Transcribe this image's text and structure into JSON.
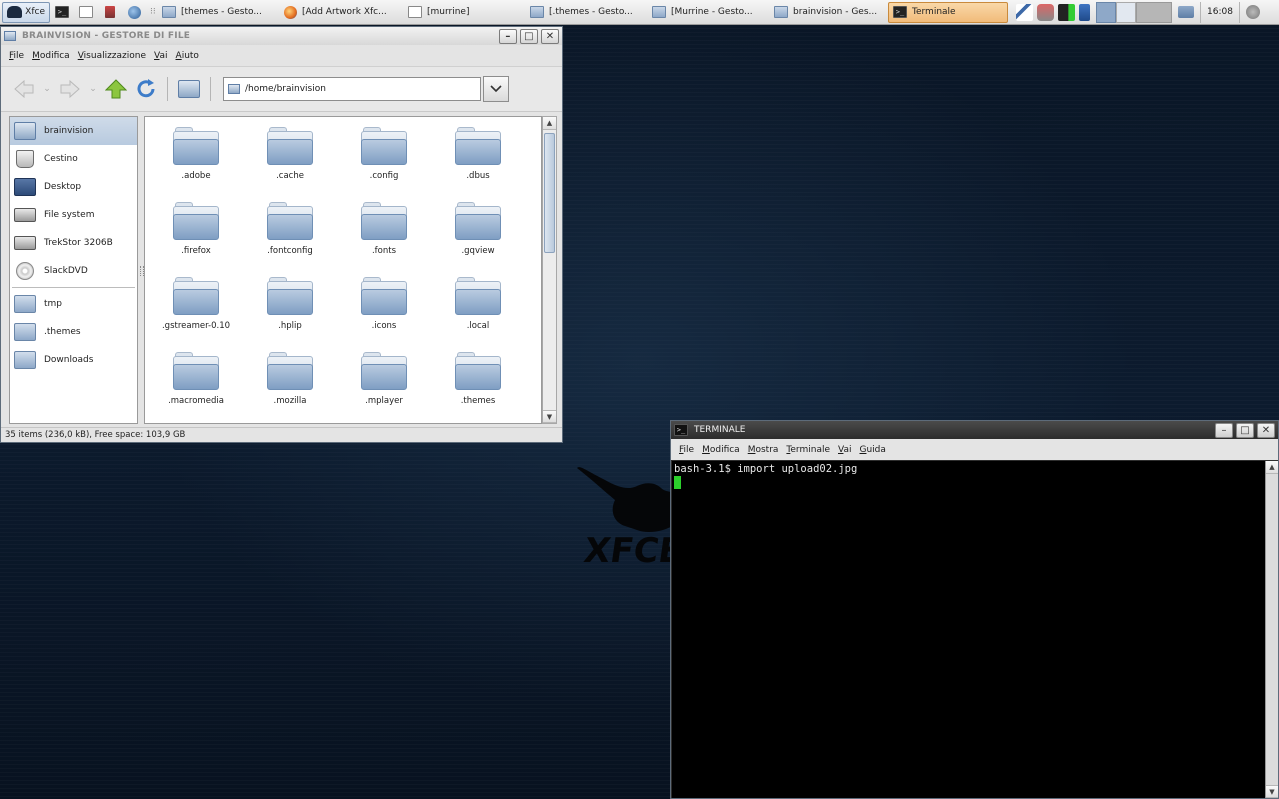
{
  "panel": {
    "xfce_label": "Xfce",
    "tasks": [
      {
        "label": "[themes - Gesto...",
        "icon": "folder-icon",
        "active": false
      },
      {
        "label": "[Add Artwork Xfc...",
        "icon": "firefox-icon",
        "active": false
      },
      {
        "label": "[murrine]",
        "icon": "document-icon",
        "active": false
      },
      {
        "label": "[.themes - Gesto...",
        "icon": "folder-icon",
        "active": false
      },
      {
        "label": "[Murrine - Gesto...",
        "icon": "folder-icon",
        "active": false
      },
      {
        "label": "brainvision - Ges...",
        "icon": "home-folder-icon",
        "active": false
      },
      {
        "label": "Terminale",
        "icon": "terminal-icon",
        "active": true
      }
    ],
    "clock": "16:08"
  },
  "file_manager": {
    "title": "BRAINVISION - GESTORE DI FILE",
    "menu": [
      "File",
      "Modifica",
      "Visualizzazione",
      "Vai",
      "Aiuto"
    ],
    "path": "/home/brainvision",
    "sidebar": [
      {
        "label": "brainvision",
        "icon": "home-icon",
        "selected": true
      },
      {
        "label": "Cestino",
        "icon": "trash-icon",
        "selected": false
      },
      {
        "label": "Desktop",
        "icon": "desktop-icon",
        "selected": false
      },
      {
        "label": "File system",
        "icon": "drive-icon",
        "selected": false
      },
      {
        "label": "TrekStor 3206B",
        "icon": "drive-icon",
        "selected": false
      },
      {
        "label": "SlackDVD",
        "icon": "cdrom-icon",
        "selected": false
      }
    ],
    "bookmarks": [
      {
        "label": "tmp",
        "icon": "folder-icon"
      },
      {
        "label": ".themes",
        "icon": "folder-icon"
      },
      {
        "label": "Downloads",
        "icon": "folder-icon"
      }
    ],
    "folders": [
      ".adobe",
      ".cache",
      ".config",
      ".dbus",
      ".firefox",
      ".fontconfig",
      ".fonts",
      ".gqview",
      ".gstreamer-0.10",
      ".hplip",
      ".icons",
      ".local",
      ".macromedia",
      ".mozilla",
      ".mplayer",
      ".themes"
    ],
    "status": "35 items (236,0 kB), Free space: 103,9 GB"
  },
  "terminal": {
    "title": "TERMINALE",
    "menu": [
      "File",
      "Modifica",
      "Mostra",
      "Terminale",
      "Vai",
      "Guida"
    ],
    "line1": "bash-3.1$ import upload02.jpg"
  },
  "colors": {
    "active_task": "#f1bb7a",
    "selection": "#b8cadf",
    "cursor": "#2cd12c",
    "desktop": "#0c1b2e"
  }
}
